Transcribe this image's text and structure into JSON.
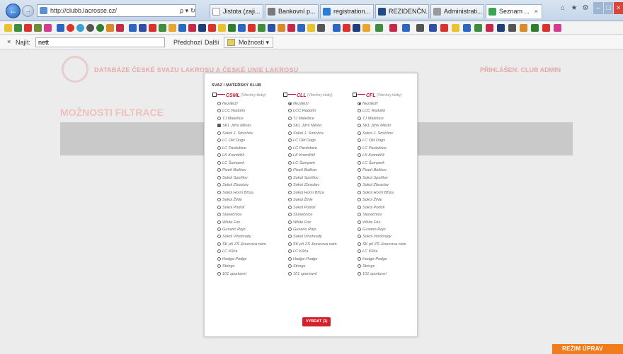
{
  "browser": {
    "address": "http://clubb.lacrosse.cz/",
    "address_controls": "ρ ▾ ↻",
    "tabs": [
      {
        "label": "Jistota (zaji...",
        "color": "#ffffff"
      },
      {
        "label": "Bankovní p...",
        "color": "#7a7a7a"
      },
      {
        "label": "registration...",
        "color": "#2a7fd4"
      },
      {
        "label": "REZIDENČN...",
        "color": "#214a86"
      },
      {
        "label": "Administrati...",
        "color": "#9a9a9a"
      },
      {
        "label": "Seznam ...",
        "color": "#3aa655",
        "active": true
      }
    ],
    "tab_close": "×",
    "back_icon": "←",
    "forward_icon": "→"
  },
  "findbar": {
    "close": "×",
    "label": "Najít:",
    "value": "nett",
    "prev": "Předchozí",
    "next": "Další",
    "options": "Možnosti ▾"
  },
  "page": {
    "site_title": "DATABÁZE ČESKÉ SVAZU LAKROSU A ČESKÉ UNIE LAKROSU",
    "login": "PŘIHLÁŠEN: CLUB ADMIN",
    "filters_title": "MOŽNOSTI FILTRACE",
    "mode_button": "REŽIM ÚPRAV"
  },
  "modal": {
    "heading": "SVAZ / MATEŘSKÝ KLUB",
    "columns": [
      {
        "abbr": "ČSML",
        "hint": "(Všechny kluby)",
        "selected": 3,
        "mark": "square"
      },
      {
        "abbr": "ČLL",
        "hint": "(Všechny kluby)",
        "selected": 0,
        "mark": "radio"
      },
      {
        "abbr": "ČFL",
        "hint": "(Všechny kluby)",
        "selected": 0,
        "mark": "radio"
      }
    ],
    "options": [
      "Nezáleží",
      "LCC Radotín",
      "TJ Malešice",
      "SKL Jižní Město",
      "Sokol J. Smíchov",
      "LC Old Dogs",
      "LC Pardubice",
      "LK Kroměříž",
      "LC Šumperk",
      "Pizeň Božkov",
      "Sokol Spořilov",
      "Sokol Zbraslav",
      "Sokol Horní Bříza",
      "Sokol Žihle",
      "Sokol Podolí",
      "Slunečnice",
      "White Fox",
      "Gusano Rojo",
      "Sokol Vinohrady",
      "ŠK při ZŠ Jiravcova nám.",
      "LC Kůča",
      "Hodge-Podge",
      "Strings",
      "101 sportovní"
    ],
    "confirm": "VYBRAT (1)"
  }
}
